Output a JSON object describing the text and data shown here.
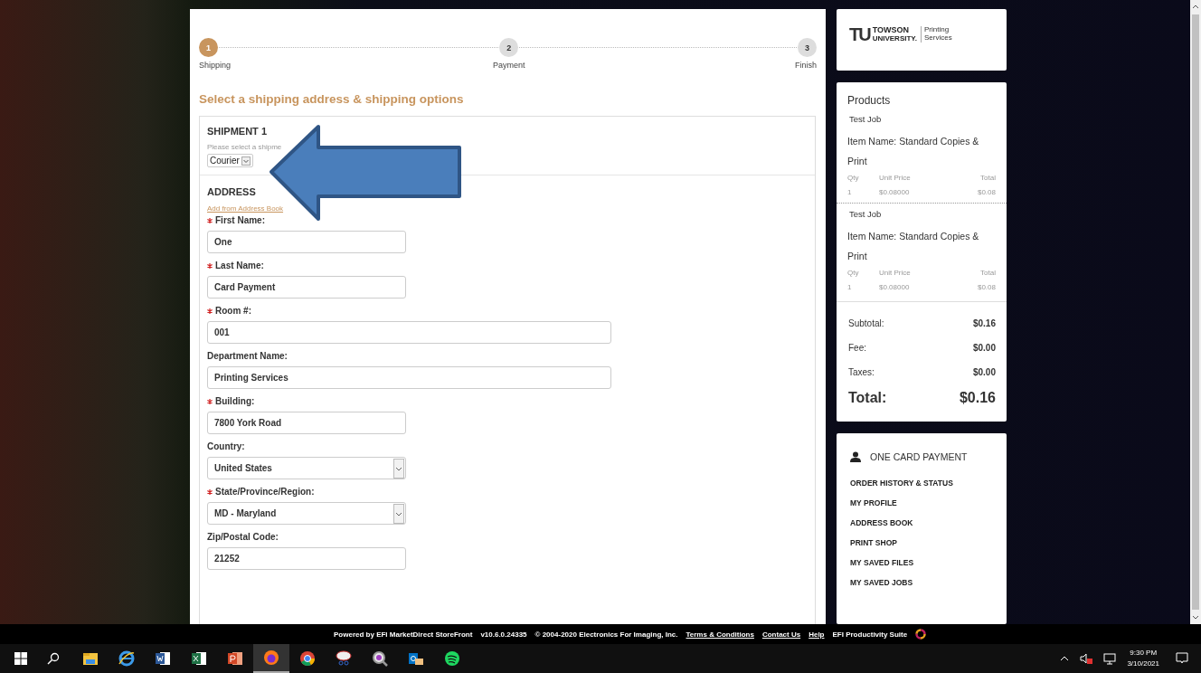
{
  "steps": [
    {
      "number": "1",
      "label": "Shipping",
      "selected": true
    },
    {
      "number": "2",
      "label": "Payment",
      "selected": false
    },
    {
      "number": "3",
      "label": "Finish",
      "selected": false
    }
  ],
  "heading": "Select a shipping address & shipping options",
  "shipment": {
    "title": "SHIPMENT 1",
    "hint": "Please select a shipme",
    "method": "Courier"
  },
  "address": {
    "title": "ADDRESS",
    "link": "Add from Address Book",
    "fields": [
      {
        "label": "First Name:",
        "required": true,
        "kind": "text",
        "wide": false,
        "value": "One"
      },
      {
        "label": "Last Name:",
        "required": true,
        "kind": "text",
        "wide": false,
        "value": "Card Payment"
      },
      {
        "label": "Room #:",
        "required": true,
        "kind": "text",
        "wide": true,
        "value": "001"
      },
      {
        "label": "Department Name:",
        "required": false,
        "kind": "text",
        "wide": true,
        "value": "Printing Services"
      },
      {
        "label": "Building:",
        "required": true,
        "kind": "text",
        "wide": false,
        "value": "7800 York Road"
      },
      {
        "label": "Country:",
        "required": false,
        "kind": "select",
        "wide": false,
        "value": "United States"
      },
      {
        "label": "State/Province/Region:",
        "required": true,
        "kind": "select",
        "wide": false,
        "value": "MD - Maryland"
      },
      {
        "label": "Zip/Postal Code:",
        "required": false,
        "kind": "text",
        "wide": false,
        "value": "21252"
      }
    ]
  },
  "logo": {
    "mark": "TU",
    "name_1": "TOWSON",
    "name_2": "UNIVERSITY.",
    "unit_1": "Printing",
    "unit_2": "Services"
  },
  "products": {
    "title": "Products",
    "items": [
      {
        "job": "Test Job",
        "item_name": "Item Name: Standard Copies & Print",
        "qty_label": "Qty",
        "unit_label": "Unit Price",
        "total_label": "Total",
        "qty": "1",
        "unit": "$0.08000",
        "total": "$0.08"
      },
      {
        "job": "Test Job",
        "item_name": "Item Name: Standard Copies & Print",
        "qty_label": "Qty",
        "unit_label": "Unit Price",
        "total_label": "Total",
        "qty": "1",
        "unit": "$0.08000",
        "total": "$0.08"
      }
    ],
    "summary": [
      {
        "label": "Subtotal:",
        "value": "$0.16"
      },
      {
        "label": "Fee:",
        "value": "$0.00"
      },
      {
        "label": "Taxes:",
        "value": "$0.00"
      }
    ],
    "total": {
      "label": "Total:",
      "value": "$0.16"
    }
  },
  "account": {
    "user": "ONE CARD PAYMENT",
    "items": [
      "ORDER HISTORY & STATUS",
      "MY PROFILE",
      "ADDRESS BOOK",
      "PRINT SHOP",
      "MY SAVED FILES",
      "MY SAVED JOBS"
    ]
  },
  "footer": {
    "texts": [
      "Powered by EFI MarketDirect StoreFront",
      "v10.6.0.24335",
      "© 2004-2020 Electronics For Imaging, Inc."
    ],
    "links": [
      "Terms & Conditions",
      "Contact Us",
      "Help"
    ],
    "suite": "EFI Productivity Suite"
  },
  "taskbar": {
    "apps": [
      {
        "kind": "folder",
        "selected": false
      },
      {
        "kind": "ie",
        "selected": false
      },
      {
        "kind": "word",
        "selected": false
      },
      {
        "kind": "excel",
        "selected": false
      },
      {
        "kind": "powerpoint",
        "selected": false
      },
      {
        "kind": "firefox",
        "selected": true
      },
      {
        "kind": "chrome",
        "selected": false
      },
      {
        "kind": "snip",
        "selected": false
      },
      {
        "kind": "magnifier",
        "selected": false
      },
      {
        "kind": "outlook",
        "selected": false
      },
      {
        "kind": "spotify",
        "selected": false
      }
    ],
    "time": "9:30 PM",
    "date": "3/10/2021"
  }
}
